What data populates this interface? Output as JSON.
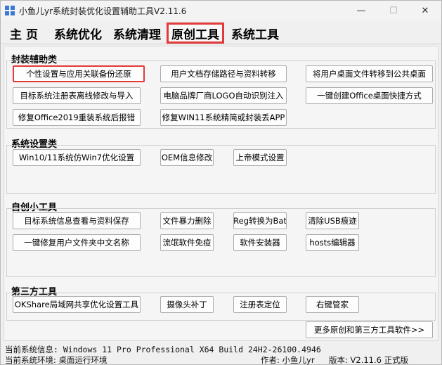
{
  "window": {
    "title": "小鱼儿yr系统封装优化设置辅助工具V2.11.6",
    "minimize": "—",
    "maximize": "☐",
    "close": "✕"
  },
  "tabs": [
    {
      "label": "主 页",
      "active": false
    },
    {
      "label": "系统优化",
      "active": false
    },
    {
      "label": "系统清理",
      "active": false
    },
    {
      "label": "原创工具",
      "active": true
    },
    {
      "label": "系统工具",
      "active": false
    }
  ],
  "groups": {
    "packaging": {
      "title": "封装辅助类",
      "buttons": [
        "个性设置与应用关联备份还原",
        "用户文档存储路径与资料转移",
        "将用户桌面文件转移到公共桌面",
        "目标系统注册表离线修改与导入",
        "电脑品牌厂商LOGO自动识别注入",
        "一键创建Office桌面快捷方式",
        "修复Office2019重装系统后报错",
        "修复WIN11系统精简或封装丢APP"
      ]
    },
    "system_settings": {
      "title": "系统设置类",
      "buttons": [
        "Win10/11系统仿Win7优化设置",
        "OEM信息修改",
        "上帝模式设置"
      ]
    },
    "self_made": {
      "title": "自创小工具",
      "buttons": [
        "目标系统信息查看与资料保存",
        "文件暴力删除",
        "Reg转换为Bat",
        "清除USB痕迹",
        "一键修复用户文件夹中文名称",
        "流氓软件免疫",
        "软件安装器",
        "hosts编辑器"
      ]
    },
    "third_party": {
      "title": "第三方工具",
      "buttons": [
        "OKShare局域网共享优化设置工具",
        "摄像头补丁",
        "注册表定位",
        "右键管家"
      ]
    }
  },
  "more_button": "更多原创和第三方工具软件>>",
  "status": {
    "system_info": "当前系统信息: Windows 11 Pro Professional X64 Build 24H2-26100.4946",
    "system_env": "当前系统环境: 桌面运行环境",
    "author": "作者: 小鱼儿yr",
    "version": "版本: V2.11.6 正式版"
  },
  "colors": {
    "highlight": "#e23a3a",
    "background": "#f0f0f0"
  }
}
